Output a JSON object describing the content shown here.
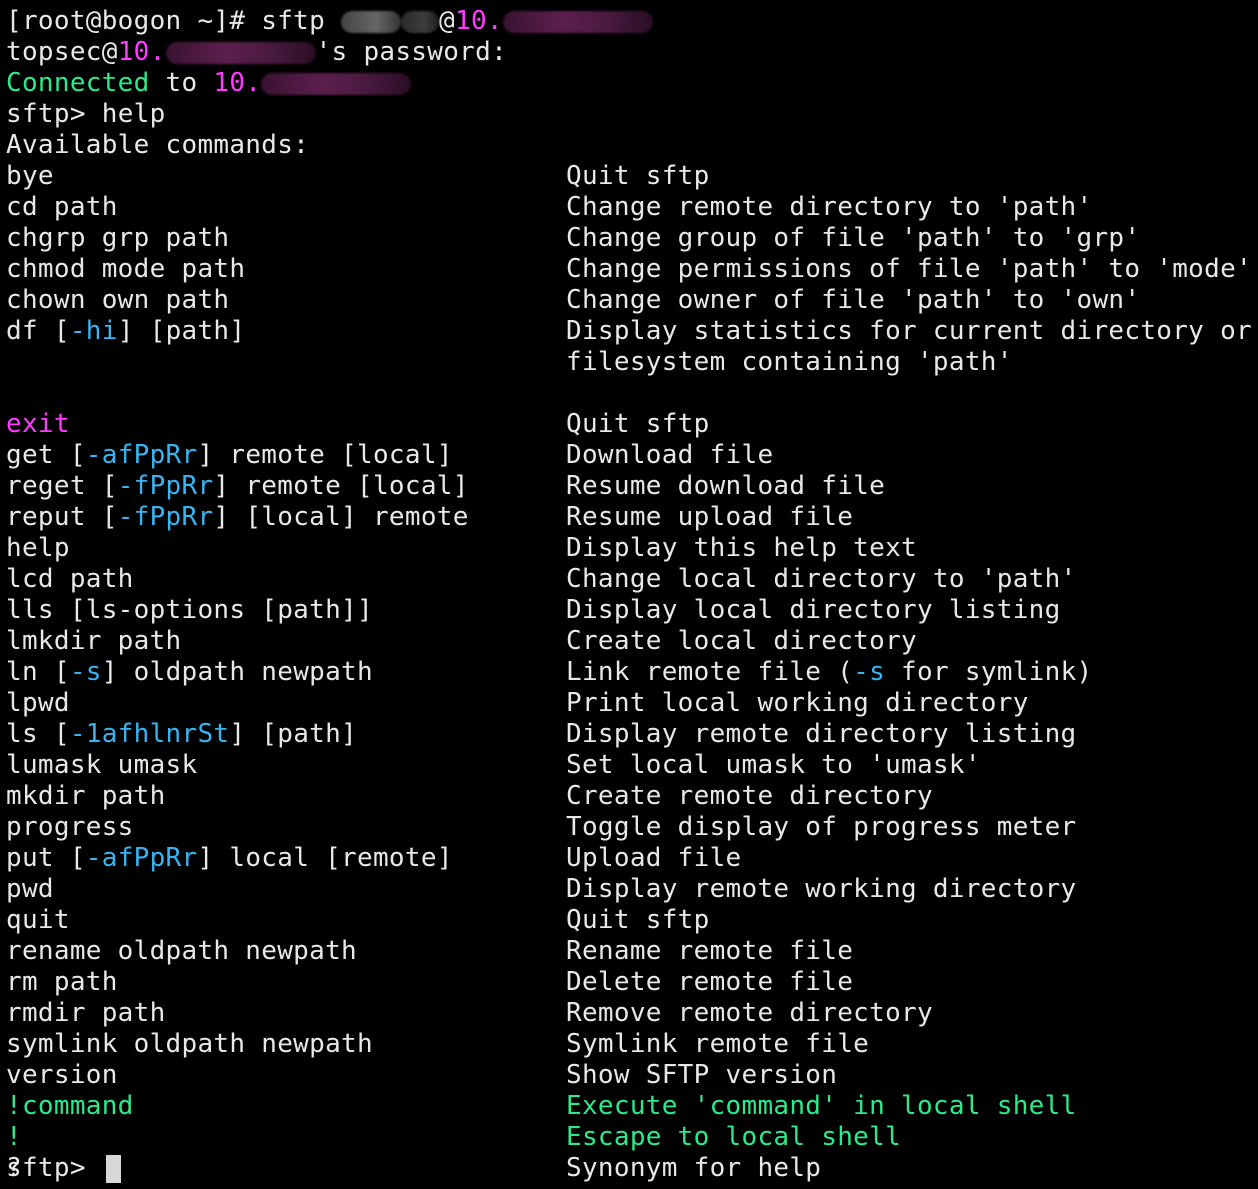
{
  "session": {
    "shell_prompt": "[root@bogon ~]# ",
    "command": "sftp ",
    "at": "@",
    "ip_prefix": "10.",
    "user": "topsec",
    "password_suffix": "'s password:",
    "connected_word": "Connected",
    "connected_to": " to ",
    "sftp_prompt": "sftp> ",
    "help_cmd": "help",
    "available": "Available commands:"
  },
  "commands": [
    {
      "name": "bye",
      "description": "Quit sftp"
    },
    {
      "name": "cd path",
      "description": "Change remote directory to 'path'"
    },
    {
      "name": "chgrp grp path",
      "description": "Change group of file 'path' to 'grp'"
    },
    {
      "name": "chmod mode path",
      "description": "Change permissions of file 'path' to 'mode'"
    },
    {
      "name": "chown own path",
      "description": "Change owner of file 'path' to 'own'"
    },
    {
      "name_a": "df [",
      "opt": "-hi",
      "name_b": "] [path]",
      "description": "Display statistics for current directory or",
      "description2": "filesystem containing 'path'"
    },
    {
      "name": "exit",
      "description": "Quit sftp"
    },
    {
      "name_a": "get [",
      "opt": "-afPpRr",
      "name_b": "] remote [local]",
      "description": "Download file"
    },
    {
      "name_a": "reget [",
      "opt": "-fPpRr",
      "name_b": "] remote [local]",
      "description": "Resume download file"
    },
    {
      "name_a": "reput [",
      "opt": "-fPpRr",
      "name_b": "] [local] remote",
      "description": "Resume upload file"
    },
    {
      "name": "help",
      "description": "Display this help text"
    },
    {
      "name": "lcd path",
      "description": "Change local directory to 'path'"
    },
    {
      "name": "lls [ls-options [path]]",
      "description": "Display local directory listing"
    },
    {
      "name": "lmkdir path",
      "description": "Create local directory"
    },
    {
      "name_a": "ln [",
      "opt": "-s",
      "name_b": "] oldpath newpath",
      "description_a": "Link remote file (",
      "desc_opt": "-s",
      "description_b": " for symlink)"
    },
    {
      "name": "lpwd",
      "description": "Print local working directory"
    },
    {
      "name_a": "ls [",
      "opt": "-1afhlnrSt",
      "name_b": "] [path]",
      "description": "Display remote directory listing"
    },
    {
      "name": "lumask umask",
      "description": "Set local umask to 'umask'"
    },
    {
      "name": "mkdir path",
      "description": "Create remote directory"
    },
    {
      "name": "progress",
      "description": "Toggle display of progress meter"
    },
    {
      "name_a": "put [",
      "opt": "-afPpRr",
      "name_b": "] local [remote]",
      "description": "Upload file"
    },
    {
      "name": "pwd",
      "description": "Display remote working directory"
    },
    {
      "name": "quit",
      "description": "Quit sftp"
    },
    {
      "name": "rename oldpath newpath",
      "description": "Rename remote file"
    },
    {
      "name": "rm path",
      "description": "Delete remote file"
    },
    {
      "name": "rmdir path",
      "description": "Remove remote directory"
    },
    {
      "name": "symlink oldpath newpath",
      "description": "Symlink remote file"
    },
    {
      "name": "version",
      "description": "Show SFTP version"
    },
    {
      "name": "!command",
      "description": "Execute 'command' in local shell"
    },
    {
      "name": "!",
      "description": "Escape to local shell"
    },
    {
      "name": "?",
      "description": "Synonym for help"
    }
  ],
  "colors": {
    "background": "#000000",
    "text": "#e8e8e8",
    "ip_magenta": "#ff3bff",
    "connected_green": "#2ee88a",
    "option_cyan": "#39b4f0"
  }
}
